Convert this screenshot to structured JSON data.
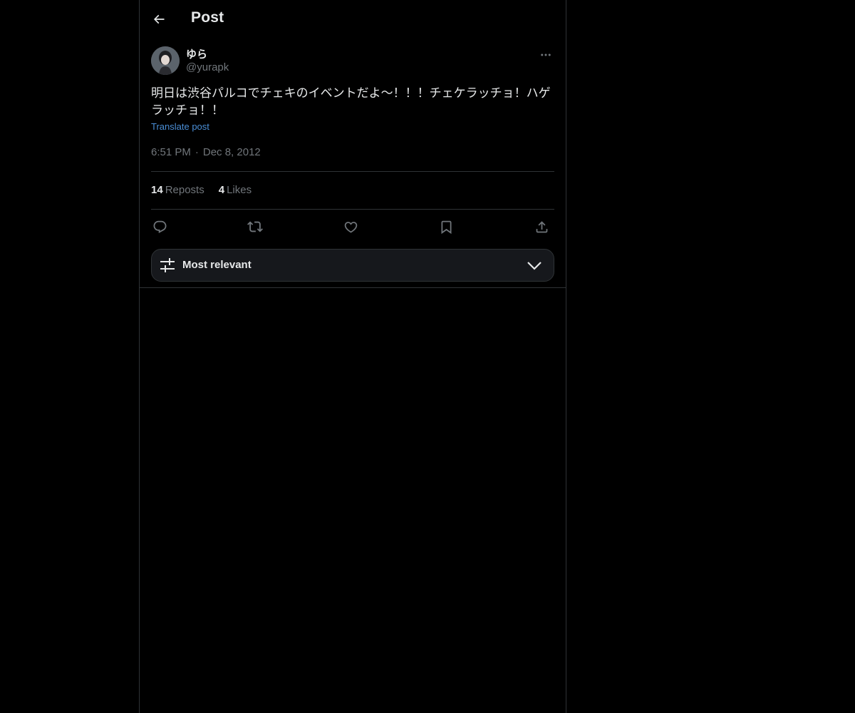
{
  "header": {
    "title": "Post",
    "back_icon": "arrow-left-icon"
  },
  "post": {
    "author": {
      "display_name": "ゆら",
      "handle": "@yurapk",
      "avatar": "avatar-photo"
    },
    "text": "明日は渋谷パルコでチェキのイベントだよ〜！！！チェケラッチョ！ハゲラッチョ！！",
    "translate_label": "Translate post",
    "time": "6:51 PM",
    "separator": "·",
    "date": "Dec 8, 2012",
    "more_icon": "more-horizontal-icon"
  },
  "stats": {
    "reposts_count": "14",
    "reposts_label": "Reposts",
    "likes_count": "4",
    "likes_label": "Likes"
  },
  "actions": [
    {
      "name": "reply",
      "icon": "reply-icon"
    },
    {
      "name": "repost",
      "icon": "repost-icon"
    },
    {
      "name": "like",
      "icon": "heart-icon"
    },
    {
      "name": "bookmark",
      "icon": "bookmark-icon"
    },
    {
      "name": "share",
      "icon": "share-icon"
    }
  ],
  "sort": {
    "label": "Most relevant",
    "icon": "sliders-icon",
    "chevron": "chevron-down-icon"
  },
  "colors": {
    "background": "#000000",
    "text": "#e7e9ea",
    "secondary_text": "#71767b",
    "link": "#4a8ed6",
    "border": "#2f3336",
    "sort_bg": "#16181c"
  }
}
